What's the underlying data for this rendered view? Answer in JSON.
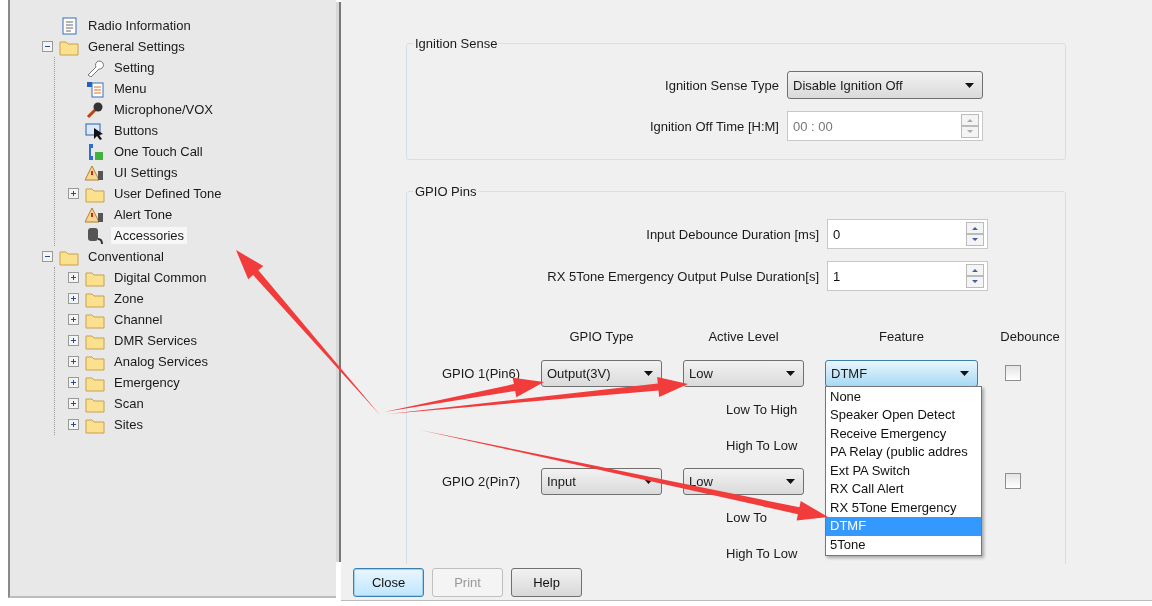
{
  "tree": [
    {
      "label": "Radio Information",
      "kind": "document"
    },
    {
      "label": "General Settings",
      "kind": "folder",
      "expanded": true,
      "children": [
        {
          "label": "Setting",
          "kind": "wrench"
        },
        {
          "label": "Menu",
          "kind": "menu"
        },
        {
          "label": "Microphone/VOX",
          "kind": "mic"
        },
        {
          "label": "Buttons",
          "kind": "cursor"
        },
        {
          "label": "One Touch Call",
          "kind": "phone"
        },
        {
          "label": "UI Settings",
          "kind": "alert"
        },
        {
          "label": "User Defined Tone",
          "kind": "folder",
          "expanded": false
        },
        {
          "label": "Alert Tone",
          "kind": "alert"
        },
        {
          "label": "Accessories",
          "kind": "accessory",
          "selected": true
        }
      ]
    },
    {
      "label": "Conventional",
      "kind": "folder",
      "expanded": true,
      "children": [
        {
          "label": "Digital Common",
          "kind": "folder",
          "expanded": false
        },
        {
          "label": "Zone",
          "kind": "folder",
          "expanded": false
        },
        {
          "label": "Channel",
          "kind": "folder",
          "expanded": false
        },
        {
          "label": "DMR Services",
          "kind": "folder",
          "expanded": false
        },
        {
          "label": "Analog Services",
          "kind": "folder",
          "expanded": false
        },
        {
          "label": "Emergency",
          "kind": "folder",
          "expanded": false
        },
        {
          "label": "Scan",
          "kind": "folder",
          "expanded": false
        },
        {
          "label": "Sites",
          "kind": "folder",
          "expanded": false
        }
      ]
    }
  ],
  "ignition": {
    "title": "Ignition Sense",
    "fields": [
      {
        "kind": "select",
        "label": "Ignition Sense Type",
        "value": "Disable Ignition Off"
      },
      {
        "kind": "spin",
        "label": "Ignition Off Time [H:M]",
        "value": "00 : 00",
        "disabled": true
      }
    ]
  },
  "gpio": {
    "title": "GPIO Pins",
    "fields": [
      {
        "kind": "spin",
        "label": "Input Debounce Duration [ms]",
        "value": "0",
        "disabled": false
      },
      {
        "kind": "spin",
        "label": "RX 5Tone Emergency Output Pulse Duration[s]",
        "value": "1",
        "disabled": false
      }
    ],
    "columns": [
      "GPIO Type",
      "Active Level",
      "Feature",
      "Debounce"
    ],
    "pins": [
      {
        "label": "GPIO 1(Pin6)",
        "type": "Output(3V)",
        "active_level": "Low",
        "feature": "DTMF",
        "debounce": false,
        "edges": [
          "Low To High",
          "High To Low"
        ],
        "feature_list": [
          {
            "label": "None",
            "selected": false
          },
          {
            "label": "Speaker Open Detect",
            "selected": false
          },
          {
            "label": "Receive Emergency",
            "selected": false
          },
          {
            "label": "PA Relay (public addres",
            "selected": false
          },
          {
            "label": "Ext PA Switch",
            "selected": false
          },
          {
            "label": "RX Call Alert",
            "selected": false
          },
          {
            "label": "RX 5Tone Emergency",
            "selected": false
          },
          {
            "label": "DTMF",
            "selected": true
          },
          {
            "label": "5Tone",
            "selected": false
          }
        ]
      },
      {
        "label": "GPIO 2(Pin7)",
        "type": "Input",
        "active_level": "Low",
        "debounce": false,
        "edges": [
          "Low To",
          "High To Low"
        ]
      }
    ]
  },
  "buttons": [
    {
      "label": "Close",
      "disabled": false,
      "default": true
    },
    {
      "label": "Print",
      "disabled": true,
      "default": false
    },
    {
      "label": "Help",
      "disabled": false,
      "default": false
    }
  ]
}
